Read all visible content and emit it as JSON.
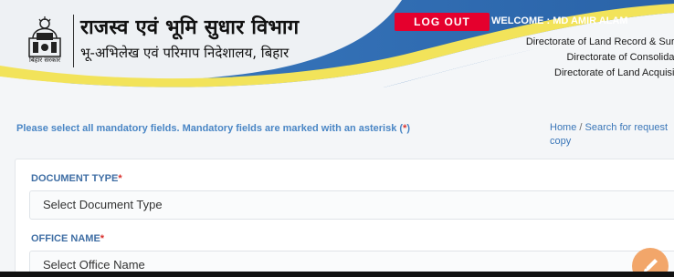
{
  "header": {
    "title_main": "राजस्व एवं भूमि सुधार विभाग",
    "title_sub": "भू-अभिलेख एवं परिमाप निदेशालय, बिहार",
    "emblem_caption": "बिहार सरकार",
    "logout_label": "LOG OUT",
    "welcome_text": "WELCOME : MD AMIR ALAM",
    "directorates": [
      "Directorate of Land Record & Surv",
      "Directorate of Consolidati",
      "Directorate of Land Acquisiti"
    ],
    "colors": {
      "primary_blue": "#2f6db3",
      "accent_yellow": "#f2e35a",
      "logout_red": "#e5002d"
    }
  },
  "content": {
    "note_text": "Please select all mandatory fields. Mandatory fields are marked with an asterisk (",
    "note_star": "*",
    "note_close": ")",
    "breadcrumb": {
      "home": "Home",
      "separator": "/",
      "current": "Search for request copy"
    }
  },
  "form": {
    "document_type": {
      "label": "DOCUMENT TYPE",
      "required_mark": "*",
      "value": "Select Document Type"
    },
    "office_name": {
      "label": "OFFICE NAME",
      "required_mark": "*",
      "value": "Select Office Name"
    }
  },
  "fab": {
    "icon": "pencil-icon"
  }
}
